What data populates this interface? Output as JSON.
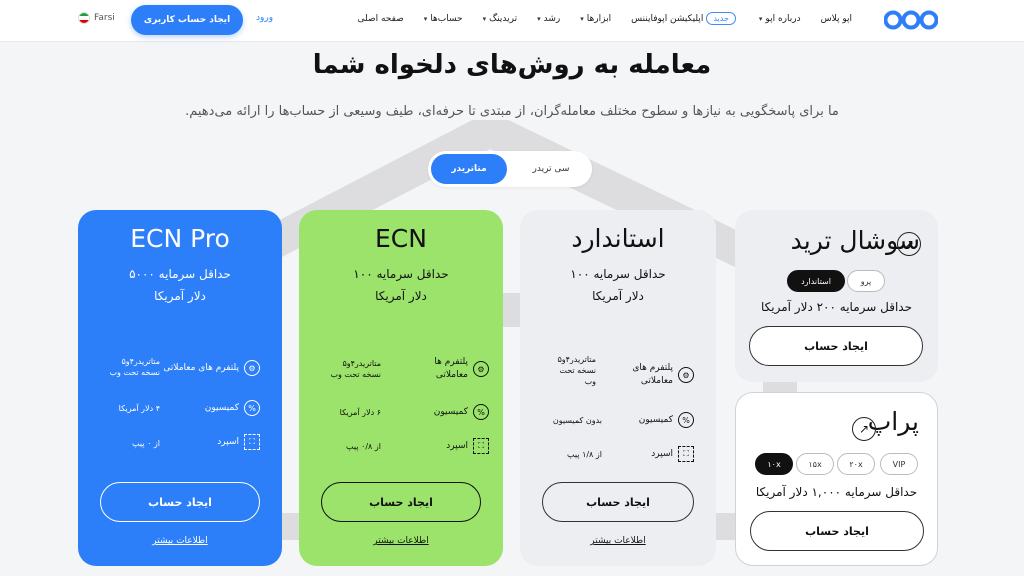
{
  "header": {
    "nav": [
      {
        "label": "صفحه اصلی",
        "chevron": false
      },
      {
        "label": "حساب‌ها",
        "chevron": true
      },
      {
        "label": "تریدینگ",
        "chevron": true
      },
      {
        "label": "رشد",
        "chevron": true
      },
      {
        "label": "ابزارها",
        "chevron": true
      },
      {
        "label": "اپلیکیشن اپوفایننس",
        "chevron": false
      },
      {
        "label": "درباره اپو",
        "chevron": true
      },
      {
        "label": "اپو پلاس",
        "chevron": false
      }
    ],
    "new_badge": "جدید",
    "login": "ورود",
    "cta": "ایجاد حساب کاربری",
    "lang": "Farsi"
  },
  "hero": {
    "title": "معامله به روش‌های دلخواه شما",
    "subtitle": "ما برای پاسخگویی به نیازها و سطوح مختلف معامله‌گران، از مبتدی تا حرفه‌ای، طیف وسیعی از حساب‌ها را ارائه می‌دهیم."
  },
  "toggle": {
    "active": "متاتریدر",
    "inactive": "سی تریدر"
  },
  "cards": {
    "ecn_pro": {
      "title": "ECN Pro",
      "min_line1": "حداقل سرمایه ۵۰۰۰",
      "min_line2": "دلار آمریکا",
      "platform_label": "پلتفرم های معاملاتی",
      "platform_value_1": "متاتریدر۴و۵",
      "platform_value_2": "نسخه تحت وب",
      "commission_label": "کمیسیون",
      "commission_value": "۴ دلار آمریکا",
      "spread_label": "اسپرد",
      "spread_value": "از ۰ پیپ",
      "button": "ایجاد حساب",
      "more": "اطلاعات بیشتر"
    },
    "ecn": {
      "title": "ECN",
      "min_line1": "حداقل سرمایه ۱۰۰",
      "min_line2": "دلار آمریکا",
      "platform_label_1": "پلتفرم ها",
      "platform_label_2": "معاملاتی",
      "platform_value_1": "متاتریدر۴و۵",
      "platform_value_2": "نسخه تحت وب",
      "commission_label": "کمیسیون",
      "commission_value": "۶ دلار آمریکا",
      "spread_label": "اسپرد",
      "spread_value": "از ۰/۸ پیپ",
      "button": "ایجاد حساب",
      "more": "اطلاعات بیشتر"
    },
    "standard": {
      "title": "استاندارد",
      "min_line1": "حداقل سرمایه ۱۰۰",
      "min_line2": "دلار آمریکا",
      "platform_label_1": "پلتفرم های",
      "platform_label_2": "معاملاتی",
      "platform_value_1": "متاتریدر۴و۵",
      "platform_value_2": "نسخه تحت",
      "platform_value_3": "وب",
      "commission_label": "کمیسیون",
      "commission_value": "بدون کمیسیون",
      "spread_label": "اسپرد",
      "spread_value": "از ۱/۸ پیپ",
      "button": "ایجاد حساب",
      "more": "اطلاعات بیشتر"
    },
    "social": {
      "title": "سوشال ترید",
      "chips": [
        "استاندارد",
        "پرو"
      ],
      "active_chip": "استاندارد",
      "min": "حداقل سرمایه ۲۰۰ دلار آمریکا",
      "button": "ایجاد حساب"
    },
    "prop": {
      "title": "پراپ",
      "chips": [
        "VIP",
        "۲۰x",
        "۱۵x",
        "۱۰x"
      ],
      "active_chip": "۱۰x",
      "min": "حداقل سرمایه ۱,۰۰۰ دلار آمریکا",
      "button": "ایجاد حساب"
    }
  },
  "colors": {
    "accent": "#2d7ff9",
    "ecn_green": "#9be36a",
    "card_grey": "#eceef1"
  }
}
